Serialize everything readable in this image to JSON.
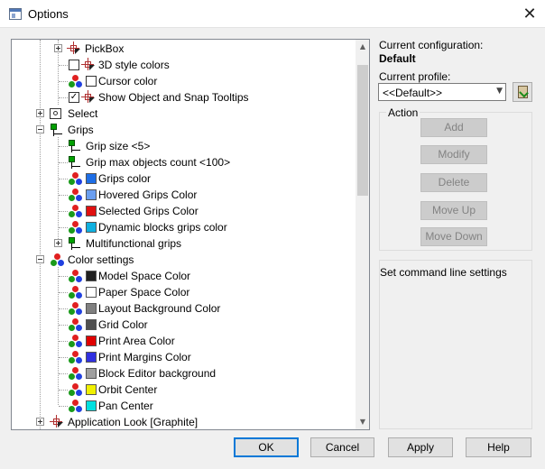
{
  "window": {
    "title": "Options"
  },
  "tree": {
    "rows": [
      {
        "label": "PickBox"
      },
      {
        "label": "3D style colors"
      },
      {
        "label": "Cursor color"
      },
      {
        "label": "Show Object and Snap Tooltips"
      },
      {
        "label": "Select"
      },
      {
        "label": "Grips"
      },
      {
        "label": "Grip size <5>"
      },
      {
        "label": "Grip max objects count <100>"
      },
      {
        "label": "Grips color",
        "swatch": "#1e6ee6"
      },
      {
        "label": "Hovered Grips Color",
        "swatch": "#6a9ef0"
      },
      {
        "label": "Selected Grips Color",
        "swatch": "#e01010"
      },
      {
        "label": "Dynamic blocks grips color",
        "swatch": "#10b0e0"
      },
      {
        "label": "Multifunctional grips"
      },
      {
        "label": "Color settings"
      },
      {
        "label": "Model Space Color",
        "swatch": "#202020"
      },
      {
        "label": "Paper Space Color",
        "swatch": "#ffffff"
      },
      {
        "label": "Layout Background Color",
        "swatch": "#808080"
      },
      {
        "label": "Grid Color",
        "swatch": "#505050"
      },
      {
        "label": "Print Area Color",
        "swatch": "#e00000"
      },
      {
        "label": "Print Margins Color",
        "swatch": "#3030e0"
      },
      {
        "label": "Block Editor background",
        "swatch": "#a0a0a0"
      },
      {
        "label": "Orbit Center",
        "swatch": "#f0f000"
      },
      {
        "label": "Pan Center",
        "swatch": "#00e0e0"
      },
      {
        "label": "Application Look [Graphite]"
      }
    ]
  },
  "side": {
    "config_label": "Current configuration:",
    "config_value": "Default",
    "profile_label": "Current profile:",
    "profile_value": "<<Default>>",
    "action_label": "Action",
    "actions": [
      "Add",
      "Modify",
      "Delete",
      "Move Up",
      "Move Down"
    ],
    "description": "Set command line settings"
  },
  "footer": {
    "ok": "OK",
    "cancel": "Cancel",
    "apply": "Apply",
    "help": "Help"
  }
}
